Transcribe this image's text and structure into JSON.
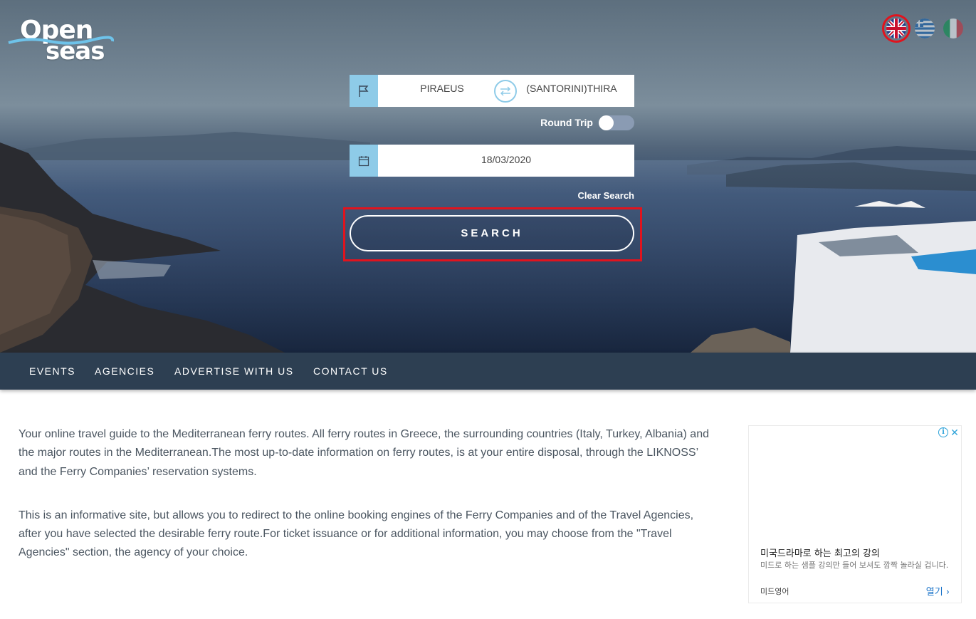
{
  "logo": {
    "line1": "Open",
    "line2": "seas"
  },
  "languages": [
    {
      "code": "en",
      "name": "English",
      "selected": true
    },
    {
      "code": "el",
      "name": "Greek",
      "selected": false
    },
    {
      "code": "it",
      "name": "Italian",
      "selected": false
    }
  ],
  "search": {
    "from": "PIRAEUS",
    "to": "(SANTORINI)THIRA",
    "round_trip_label": "Round Trip",
    "round_trip_enabled": false,
    "date": "18/03/2020",
    "clear_label": "Clear Search",
    "button_label": "SEARCH"
  },
  "nav": {
    "items": [
      {
        "label": "EVENTS"
      },
      {
        "label": "AGENCIES"
      },
      {
        "label": "ADVERTISE WITH US"
      },
      {
        "label": "CONTACT US"
      }
    ]
  },
  "content": {
    "paragraph1": "Your online travel guide to the Mediterranean ferry routes. All ferry routes in Greece, the surrounding countries (Italy, Turkey, Albania) and the major routes in the Mediterranean.The most up-to-date information on ferry routes, is at your entire disposal, through the LIKNOSS’ and the Ferry Companies’ reservation systems.",
    "paragraph2": "This is an informative site, but allows you to redirect to the online booking engines of the Ferry Companies and of the Travel Agencies, after you have selected the desirable ferry route.For ticket issuance or for additional information, you may choose from the \"Travel Agencies\" section, the agency of your choice."
  },
  "ad": {
    "title": "미국드라마로 하는 최고의 강의",
    "description": "미드로 하는 샘플 강의만 들어 보셔도 깜짝 놀라실 겁니다.",
    "source": "미드영어",
    "open_label": "열기"
  },
  "colors": {
    "nav_bg": "#2d3f52",
    "field_icon_bg": "#8ecbe8",
    "highlight": "#e0141e"
  }
}
